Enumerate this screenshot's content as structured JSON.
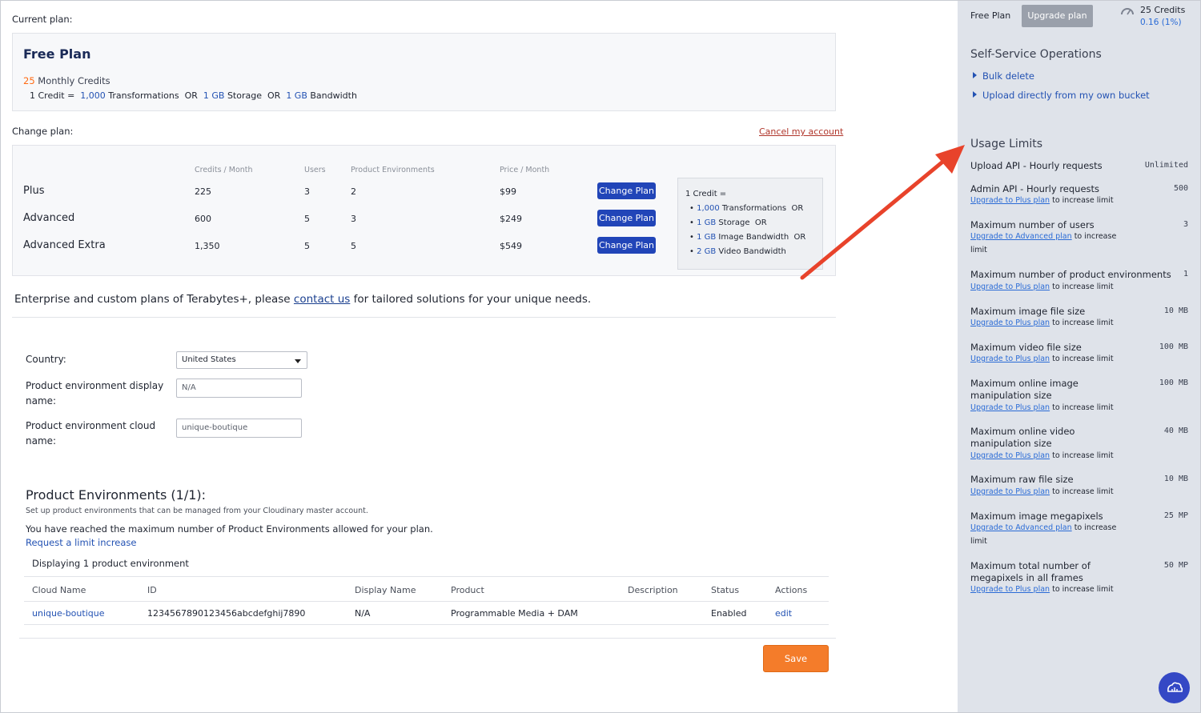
{
  "current_plan": {
    "label": "Current plan:",
    "name": "Free Plan",
    "credits": "25",
    "credits_label": "Monthly Credits",
    "formula": {
      "prefix": "1 Credit =",
      "transformations_value": "1,000",
      "transformations_label": "Transformations",
      "or1": "OR",
      "storage_value": "1 GB",
      "storage_label": "Storage",
      "or2": "OR",
      "bandwidth_value": "1 GB",
      "bandwidth_label": "Bandwidth"
    }
  },
  "change_plan": {
    "label": "Change plan:",
    "cancel_link": "Cancel my account",
    "headers": {
      "credits": "Credits / Month",
      "users": "Users",
      "envs": "Product Environments",
      "price": "Price / Month"
    },
    "button_label": "Change Plan",
    "plans": [
      {
        "name": "Plus",
        "credits": "225",
        "users": "3",
        "envs": "2",
        "price": "$99"
      },
      {
        "name": "Advanced",
        "credits": "600",
        "users": "5",
        "envs": "3",
        "price": "$249"
      },
      {
        "name": "Advanced Extra",
        "credits": "1,350",
        "users": "5",
        "envs": "5",
        "price": "$549"
      }
    ],
    "credit_box": {
      "title": "1 Credit =",
      "line1_value": "1,000",
      "line1_label": "Transformations",
      "line1_or": "OR",
      "line2_value": "1 GB",
      "line2_label": "Storage",
      "line2_or": "OR",
      "line3_value": "1 GB",
      "line3_label": "Image Bandwidth",
      "line3_or": "OR",
      "line4_value": "2 GB",
      "line4_label": "Video Bandwidth"
    }
  },
  "enterprise": {
    "before": "Enterprise and custom plans of Terabytes+, please",
    "link": "contact us",
    "after": "for tailored solutions for your unique needs."
  },
  "form": {
    "country_label": "Country:",
    "country_value": "United States",
    "display_name_label_1": "Product environment display",
    "display_name_label_2": "name:",
    "display_name_value": "N/A",
    "cloud_name_label_1": "Product environment cloud",
    "cloud_name_label_2": "name:",
    "cloud_name_value": "unique-boutique"
  },
  "product_envs": {
    "title": "Product Environments (1/1):",
    "subtitle": "Set up product environments that can be managed from your Cloudinary master account.",
    "max_msg": "You have reached the maximum number of Product Environments allowed for your plan.",
    "request_link": "Request a limit increase",
    "displaying": "Displaying 1 product environment",
    "columns": [
      "Cloud Name",
      "ID",
      "Display Name",
      "Product",
      "Description",
      "Status",
      "Actions"
    ],
    "rows": [
      {
        "cloud_name": "unique-boutique",
        "id": "1234567890123456abcdefghij7890",
        "display_name": "N/A",
        "product": "Programmable Media + DAM",
        "description": "",
        "status": "Enabled",
        "action": "edit"
      }
    ],
    "save_label": "Save"
  },
  "sidebar": {
    "plan_label": "Free Plan",
    "upgrade_label": "Upgrade plan",
    "credits_text": "25 Credits",
    "credits_usage": "0.16 (1%)",
    "ops_title": "Self-Service Operations",
    "ops_links": [
      "Bulk delete",
      "Upload directly from my own bucket"
    ],
    "limits_title": "Usage Limits",
    "note_suffix": "to increase limit",
    "limits": [
      {
        "name": "Upload API - Hourly requests",
        "value": "Unlimited"
      },
      {
        "name": "Admin API - Hourly requests",
        "value": "500",
        "upgrade": "Upgrade to Plus plan"
      },
      {
        "name": "Maximum number of users",
        "value": "3",
        "upgrade": "Upgrade to Advanced plan",
        "note_a": "to increase",
        "note_b": "limit"
      },
      {
        "name": "Maximum number of product environments",
        "value": "1",
        "upgrade": "Upgrade to Plus plan"
      },
      {
        "name": "Maximum image file size",
        "value": "10 MB",
        "upgrade": "Upgrade to Plus plan"
      },
      {
        "name": "Maximum video file size",
        "value": "100 MB",
        "upgrade": "Upgrade to Plus plan"
      },
      {
        "name_1": "Maximum online image",
        "name_2": "manipulation size",
        "value": "100 MB",
        "upgrade": "Upgrade to Plus plan"
      },
      {
        "name_1": "Maximum online video",
        "name_2": "manipulation size",
        "value": "40 MB",
        "upgrade": "Upgrade to Plus plan"
      },
      {
        "name": "Maximum raw file size",
        "value": "10 MB",
        "upgrade": "Upgrade to Plus plan"
      },
      {
        "name": "Maximum image megapixels",
        "value": "25 MP",
        "upgrade": "Upgrade to Advanced plan",
        "note_a": "to increase",
        "note_b": "limit"
      },
      {
        "name_1": "Maximum total number of",
        "name_2": "megapixels in all frames",
        "value": "50 MP",
        "upgrade": "Upgrade to Plus plan"
      }
    ]
  },
  "colors": {
    "accent_blue": "#2145b8",
    "orange": "#ff6a13",
    "arrow_red": "#e8432b",
    "sidebar_bg": "#dfe3ea"
  },
  "icons": {
    "credits": "speedometer-icon",
    "fab": "cloud-support-icon",
    "dropdown": "caret-down-icon"
  }
}
